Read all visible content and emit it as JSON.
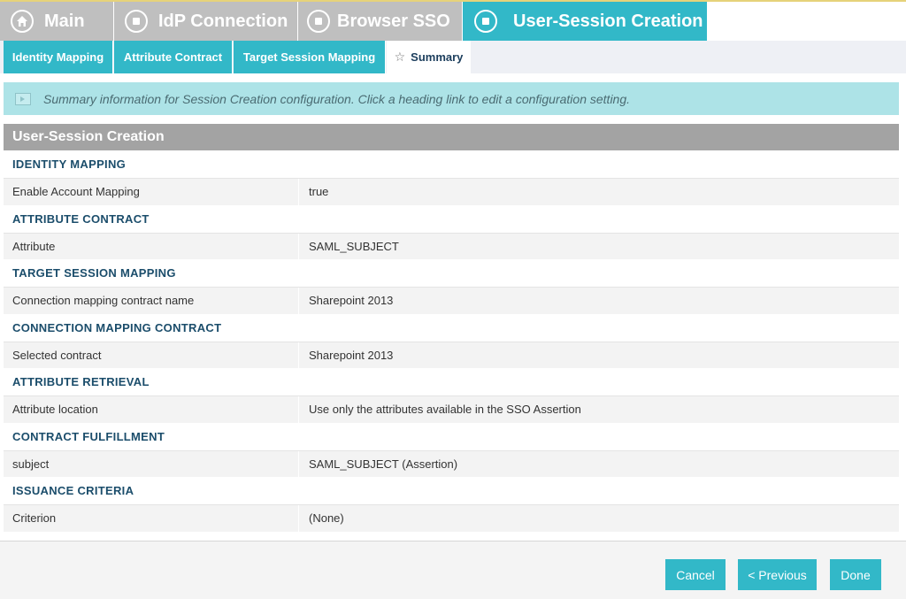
{
  "top_tabs": [
    {
      "label": "Main",
      "icon": "home-icon"
    },
    {
      "label": "IdP Connection",
      "icon": "step-icon"
    },
    {
      "label": "Browser SSO",
      "icon": "step-icon"
    },
    {
      "label": "User-Session Creation",
      "icon": "step-icon"
    }
  ],
  "sub_tabs": [
    {
      "label": "Identity Mapping"
    },
    {
      "label": "Attribute Contract"
    },
    {
      "label": "Target Session Mapping"
    },
    {
      "label": "Summary"
    }
  ],
  "info": {
    "text": "Summary information for Session Creation configuration. Click a heading link to edit a configuration setting."
  },
  "section": {
    "title": "User-Session Creation"
  },
  "groups": [
    {
      "title": "IDENTITY MAPPING",
      "key": "Enable Account Mapping",
      "value": "true"
    },
    {
      "title": "ATTRIBUTE CONTRACT",
      "key": "Attribute",
      "value": "SAML_SUBJECT"
    },
    {
      "title": "TARGET SESSION MAPPING",
      "key": "Connection mapping contract name",
      "value": "Sharepoint 2013"
    },
    {
      "title": "CONNECTION MAPPING CONTRACT",
      "key": "Selected contract",
      "value": "Sharepoint 2013"
    },
    {
      "title": "ATTRIBUTE RETRIEVAL",
      "key": "Attribute location",
      "value": "Use only the attributes available in the SSO Assertion"
    },
    {
      "title": "CONTRACT FULFILLMENT",
      "key": "subject",
      "value": "SAML_SUBJECT (Assertion)"
    },
    {
      "title": "ISSUANCE CRITERIA",
      "key": "Criterion",
      "value": "(None)"
    }
  ],
  "footer": {
    "cancel": "Cancel",
    "previous": "< Previous",
    "done": "Done"
  },
  "colors": {
    "accent": "#32b8c8",
    "tab_inactive": "#bfbfbf",
    "banner": "#ade3e7",
    "section_header": "#a3a3a3",
    "heading_text": "#1b4d6b"
  }
}
